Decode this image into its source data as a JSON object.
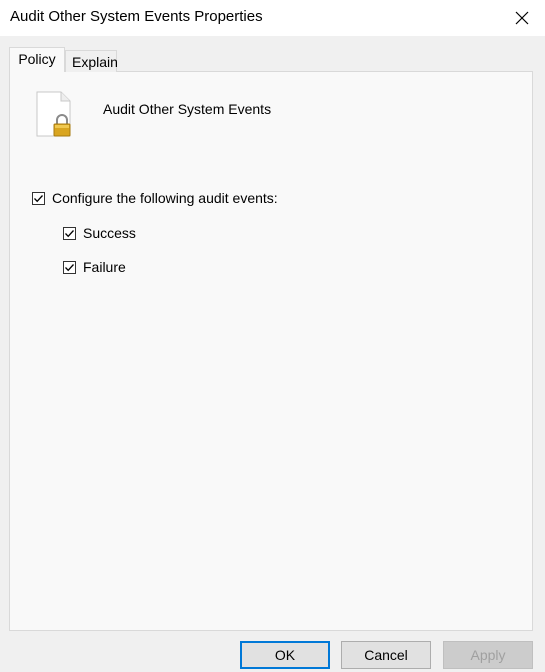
{
  "window": {
    "title": "Audit Other System Events Properties"
  },
  "tabs": [
    {
      "label": "Policy",
      "active": true
    },
    {
      "label": "Explain",
      "active": false
    }
  ],
  "policy": {
    "name": "Audit Other System Events",
    "icon": "document-lock-icon"
  },
  "options": {
    "configure": {
      "label": "Configure the following audit events:",
      "checked": true
    },
    "success": {
      "label": "Success",
      "checked": true
    },
    "failure": {
      "label": "Failure",
      "checked": true
    }
  },
  "buttons": {
    "ok": "OK",
    "cancel": "Cancel",
    "apply": "Apply"
  },
  "colors": {
    "accent": "#0078d7",
    "lock": "#d9a520"
  }
}
